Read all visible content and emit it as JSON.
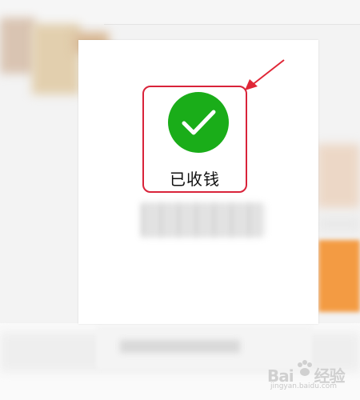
{
  "payment_status": {
    "label": "已收钱",
    "icon": "check-icon",
    "icon_color": "#1aad19",
    "highlight_color": "#d9233a"
  },
  "watermark": {
    "brand": "Bai",
    "brand_suffix": "经验",
    "url": "jingyan.baidu.com"
  }
}
